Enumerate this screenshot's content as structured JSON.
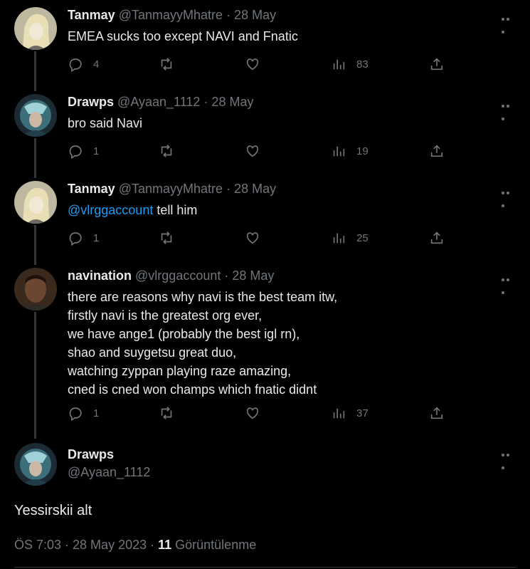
{
  "tweets": [
    {
      "name": "Tanmay",
      "handle": "@TanmayyMhatre",
      "date": "· 28 May",
      "text": "EMEA sucks too except NAVI and Fnatic",
      "replies": "4",
      "retweets": "",
      "likes": "",
      "views": "83",
      "avatar": "anime-portrait"
    },
    {
      "name": "Drawps",
      "handle": "@Ayaan_1112",
      "date": "· 28 May",
      "text": "bro said Navi",
      "replies": "1",
      "retweets": "",
      "likes": "",
      "views": "19",
      "avatar": "dark-hero-portrait"
    },
    {
      "name": "Tanmay",
      "handle": "@TanmayyMhatre",
      "date": "· 28 May",
      "mention": "@vlrggaccount",
      "text": " tell him",
      "replies": "1",
      "retweets": "",
      "likes": "",
      "views": "25",
      "avatar": "anime-portrait"
    },
    {
      "name": "navination",
      "handle": "@vlrggaccount",
      "date": "· 28 May",
      "text": "there are reasons why navi is the best team itw,\nfirstly navi is the greatest org ever,\nwe have ange1 (probably the best igl rn),\nshao and suygetsu great duo,\nwatching zyppan playing raze amazing,\ncned is cned won champs which fnatic didnt",
      "replies": "1",
      "retweets": "",
      "likes": "",
      "views": "37",
      "avatar": "man-portrait"
    }
  ],
  "main_tweet": {
    "name": "Drawps",
    "handle": "@Ayaan_1112",
    "text": "Yessirskii alt",
    "time": "ÖS 7:03 · 28 May 2023 · ",
    "views_count": "11",
    "views_label": " Görüntülenme"
  },
  "colors": {
    "background": "#000000",
    "text": "#e7e9ea",
    "muted": "#71767b",
    "link": "#1d9bf0",
    "line": "#333639"
  },
  "icons": [
    "reply-icon",
    "retweet-icon",
    "like-icon",
    "views-icon",
    "share-icon",
    "more-icon"
  ]
}
